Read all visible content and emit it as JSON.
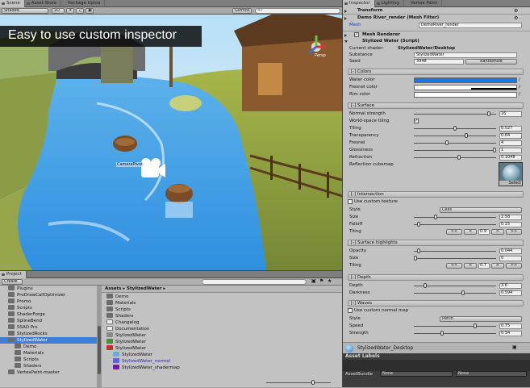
{
  "scene_tabs": {
    "scene": "Scene",
    "asset_store": "Asset Store",
    "package_upload": "Package Uploa"
  },
  "scene_toolbar": {
    "shaded": "Shaded",
    "mode_2d": "2D",
    "gizmos": "Gizmos",
    "search_placeholder": "All"
  },
  "gizmo": {
    "persp": "Persp",
    "camera_label": "CameraPivot"
  },
  "banner": "Easy to use custom inspector",
  "inspector_tabs": {
    "inspector": "Inspector",
    "lighting": "Lighting",
    "vertex_paint": "Vertex Paint"
  },
  "transform_label": "Transform",
  "mesh_filter": {
    "title": "Demo River_render (Mesh Filter)",
    "mesh_label": "Mesh",
    "mesh_value": "DemoRiver_render"
  },
  "mesh_renderer": "Mesh Renderer",
  "script_title": "Stylized Water (Script)",
  "shader_info": {
    "current_shader_label": "Current shader:",
    "current_shader": "StylizedWater/Desktop",
    "substance_label": "Substance",
    "substance": "StylizedWater",
    "seed_label": "Seed",
    "seed": "3948",
    "randomize": "Randomize"
  },
  "colors": {
    "header": "[-] Colors",
    "water": "Water color",
    "fresnel": "Fresnel color",
    "rim": "Rim color",
    "water_hex": "#1878e0"
  },
  "surface": {
    "header": "[-] Surface",
    "normal_strength_label": "Normal strength",
    "normal_strength": "16",
    "normal_strength_frac": 0.93,
    "world_space_label": "World-space tiling",
    "tiling_label": "Tiling",
    "tiling": "0.527",
    "tiling_frac": 0.5,
    "transparency_label": "Transparency",
    "transparency": "0.64",
    "transparency_frac": 0.64,
    "fresnel_label": "Fresnel",
    "fresnel": "4",
    "fresnel_frac": 0.4,
    "glossiness_label": "Glossiness",
    "glossiness": "1",
    "glossiness_frac": 1.0,
    "refraction_label": "Refraction",
    "refraction": "0.1048",
    "refraction_frac": 0.55,
    "cubemap_label": "Reflection cubemap",
    "select": "Select"
  },
  "intersection": {
    "header": "[-] Intersection",
    "use_custom": "Use custom texture",
    "style_label": "Style",
    "style": "Cells",
    "size_label": "Size",
    "size": "2.58",
    "size_frac": 0.26,
    "falloff_label": "Falloff",
    "falloff": "0.15",
    "falloff_frac": 0.04,
    "tiling_label": "Tiling",
    "tiling": "0.9"
  },
  "highlights": {
    "header": "[-] Surface highlights",
    "opacity_label": "Opacity",
    "opacity": "0.044",
    "opacity_frac": 0.04,
    "size_label": "Size",
    "size": "0",
    "size_frac": 0.0,
    "tiling_label": "Tiling",
    "tiling": "0.7"
  },
  "depth": {
    "header": "[-] Depth",
    "depth_label": "Depth",
    "depth": "3.6",
    "depth_frac": 0.12,
    "darkness_label": "Darkness",
    "darkness": "0.594",
    "darkness_frac": 0.6
  },
  "waves": {
    "header": "[-] Waves",
    "use_custom": "Use custom normal map",
    "style_label": "Style",
    "style": "Perlin",
    "speed_label": "Speed",
    "speed": "0.75",
    "speed_frac": 0.75,
    "strength_label": "Strength",
    "strength": "0.34",
    "strength_frac": 0.34
  },
  "tiling_buttons": {
    "dec_big": "<<",
    "dec": "<",
    "inc": ">",
    "inc_big": ">>"
  },
  "preview": {
    "name": "StylizedWater_Desktop"
  },
  "asset_labels": {
    "title": "Asset Labels",
    "bundle_label": "AssetBundle",
    "bundle": "None",
    "variant": "None"
  },
  "project": {
    "tab": "Project",
    "create": "Create",
    "breadcrumb": "Assets ▸ StylizedWater ▸",
    "tree": [
      "Plugins",
      "ProDrawCallOptimizer",
      "Promo",
      "Scripts",
      "ShaderForge",
      "SplineBend",
      "SSAO Pro",
      "StylizedRocks",
      "StylizedWater",
      "Demo",
      "Materials",
      "Scripts",
      "Shaders",
      "VertexPaint-master"
    ],
    "files": [
      "Demo",
      "Materials",
      "Scripts",
      "Shaders",
      "Changelog",
      "Documentation",
      "StylizedWater",
      "StylizedWater",
      "StylizedWater_normal",
      "StylizedWater_shadermap"
    ],
    "subtree": [
      "StylizedWater",
      "StylizedWater",
      "StylizedWater_normal",
      "StylizedWater_shadermap"
    ]
  }
}
